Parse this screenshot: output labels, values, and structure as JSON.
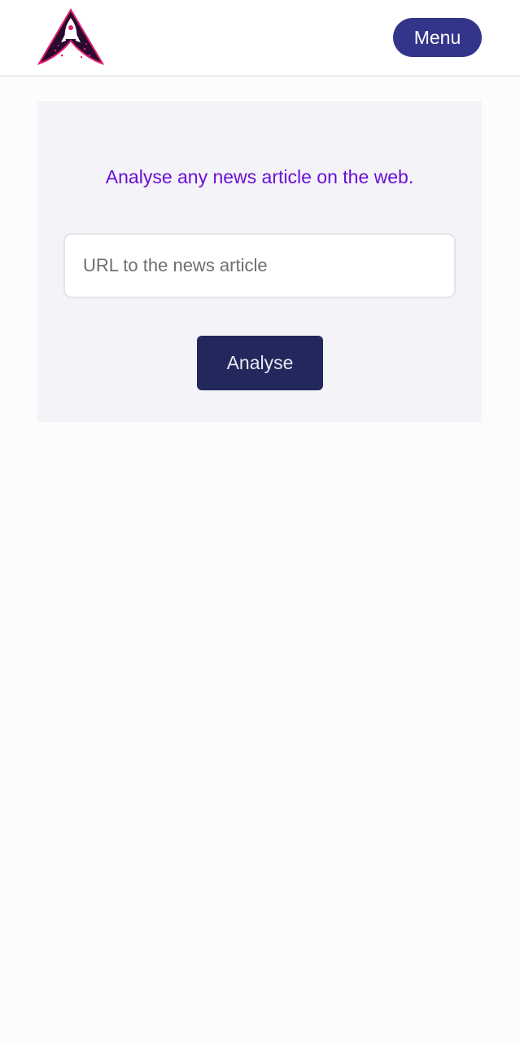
{
  "header": {
    "logo_icon": "rocket-a-logo-icon",
    "menu_label": "Menu"
  },
  "main": {
    "tagline": "Analyse any news article on the web.",
    "url_input": {
      "placeholder": "URL to the news article",
      "value": ""
    },
    "analyse_label": "Analyse"
  },
  "colors": {
    "menu_button": "#33358a",
    "tagline": "#6a0fd6",
    "analyse_button": "#22275c",
    "card_background": "#f4f3f8",
    "logo_dark": "#2a0a2e",
    "logo_accent": "#e0206f"
  }
}
